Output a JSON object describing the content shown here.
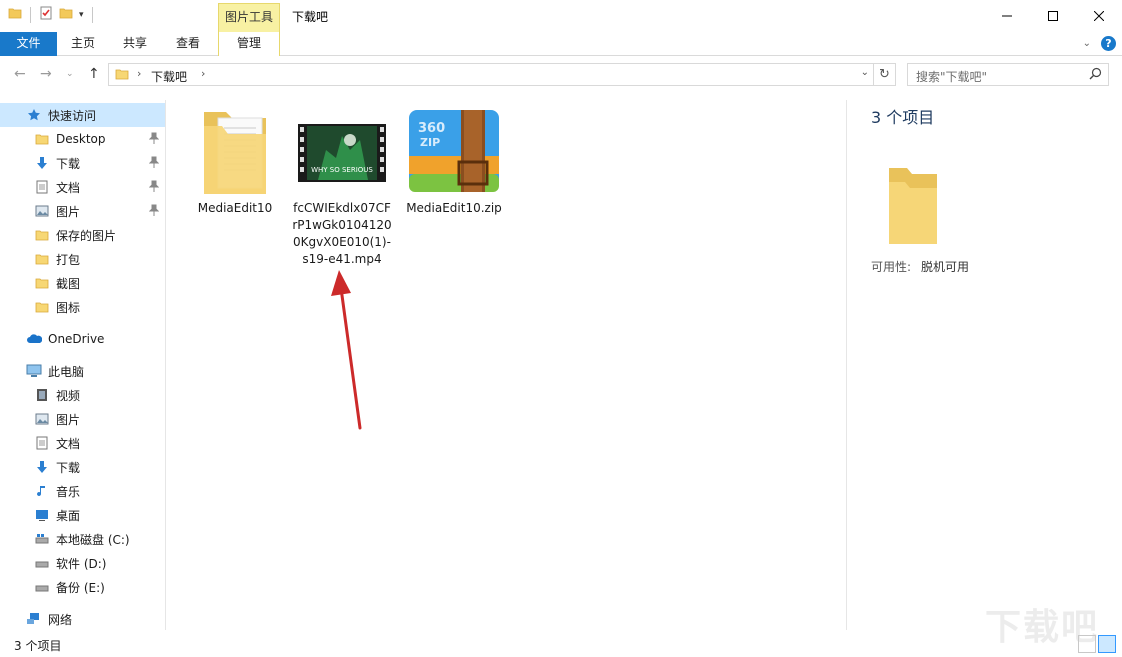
{
  "window": {
    "title": "下载吧",
    "context_tab_group": "图片工具"
  },
  "ribbon": {
    "tabs": [
      {
        "label": "文件"
      },
      {
        "label": "主页"
      },
      {
        "label": "共享"
      },
      {
        "label": "查看"
      },
      {
        "label": "管理"
      }
    ]
  },
  "address": {
    "crumb": "下载吧"
  },
  "search": {
    "placeholder": "搜索\"下载吧\""
  },
  "sidebar": {
    "items": [
      {
        "label": "快速访问",
        "icon": "star-icon",
        "pinned": false
      },
      {
        "label": "Desktop",
        "icon": "folder-icon",
        "pinned": true
      },
      {
        "label": "下载",
        "icon": "download-icon",
        "pinned": true
      },
      {
        "label": "文档",
        "icon": "document-icon",
        "pinned": true
      },
      {
        "label": "图片",
        "icon": "picture-icon",
        "pinned": true
      },
      {
        "label": "保存的图片",
        "icon": "folder-icon",
        "pinned": false
      },
      {
        "label": "打包",
        "icon": "folder-icon",
        "pinned": false
      },
      {
        "label": "截图",
        "icon": "folder-icon",
        "pinned": false
      },
      {
        "label": "图标",
        "icon": "folder-icon",
        "pinned": false
      },
      {
        "label": "OneDrive",
        "icon": "cloud-icon",
        "pinned": false
      },
      {
        "label": "此电脑",
        "icon": "computer-icon",
        "pinned": false
      },
      {
        "label": "视频",
        "icon": "video-icon",
        "pinned": false
      },
      {
        "label": "图片",
        "icon": "picture-icon",
        "pinned": false
      },
      {
        "label": "文档",
        "icon": "document-icon",
        "pinned": false
      },
      {
        "label": "下载",
        "icon": "download-icon",
        "pinned": false
      },
      {
        "label": "音乐",
        "icon": "music-icon",
        "pinned": false
      },
      {
        "label": "桌面",
        "icon": "desktop-icon",
        "pinned": false
      },
      {
        "label": "本地磁盘 (C:)",
        "icon": "drive-icon",
        "pinned": false
      },
      {
        "label": "软件 (D:)",
        "icon": "drive-icon",
        "pinned": false
      },
      {
        "label": "备份 (E:)",
        "icon": "drive-icon",
        "pinned": false
      },
      {
        "label": "网络",
        "icon": "network-icon",
        "pinned": false
      }
    ]
  },
  "files": [
    {
      "name": "MediaEdit10",
      "type": "folder"
    },
    {
      "name_lines": [
        "fcCWIEkdlx07CF",
        "rP1wGk0104120",
        "0KgvX0E010(1)-",
        "s19-e41.mp4"
      ],
      "type": "video",
      "thumb_text": "WHY SO SERIOUS"
    },
    {
      "name": "MediaEdit10.zip",
      "type": "zip",
      "badge_line1": "360",
      "badge_line2": "ZIP"
    }
  ],
  "details": {
    "count": "3 个项目",
    "availability_label": "可用性:",
    "availability_value": "脱机可用"
  },
  "status": {
    "text": "3 个项目"
  },
  "watermark": "下载吧",
  "colors": {
    "accent": "#1979ca",
    "selection": "#cce8ff",
    "context_tab": "#f8f1a3",
    "arrow": "#cc2a2a"
  }
}
